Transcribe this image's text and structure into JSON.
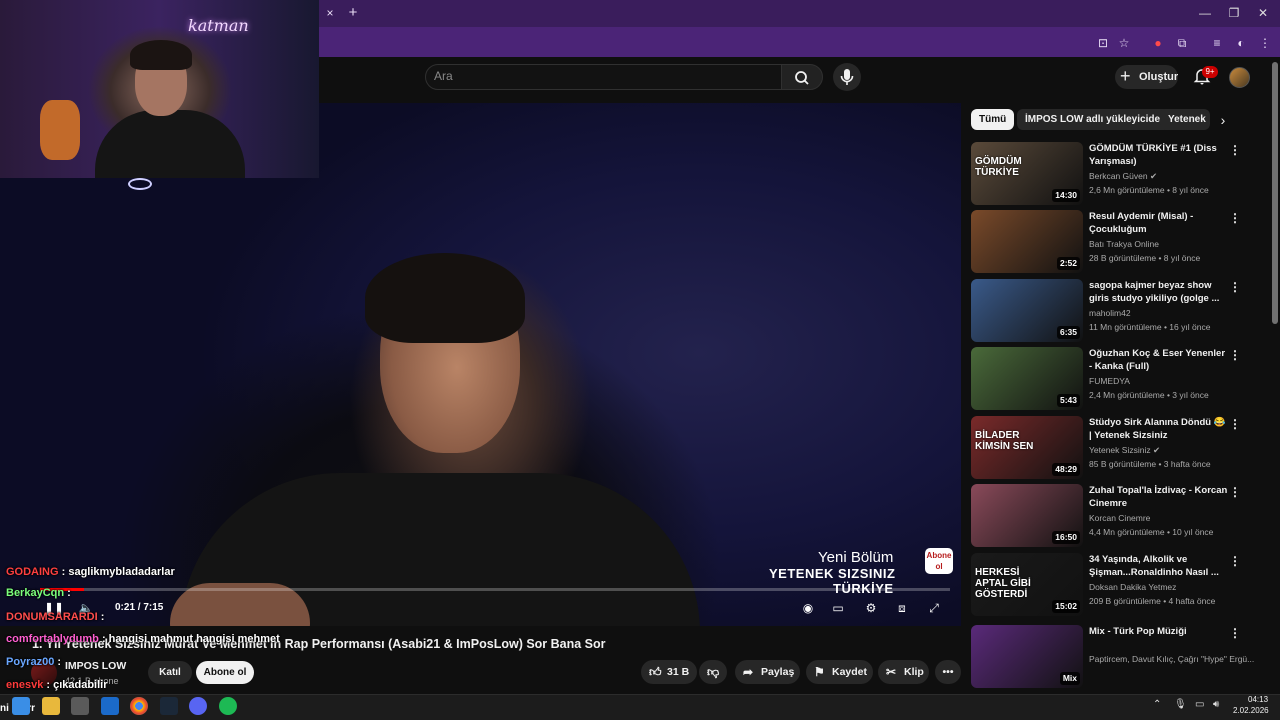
{
  "browser": {
    "tab_close": "×",
    "new_tab": "+",
    "window_min": "—",
    "window_restore": "❐",
    "window_close": "✕"
  },
  "header": {
    "search_placeholder": "Ara",
    "create_label": "Oluştur",
    "notification_count": "9+"
  },
  "stream_overlay": {
    "neon_sign": "katman"
  },
  "player": {
    "current_time": "0:21",
    "duration": "7:15",
    "time_display": "0:21 / 7:15",
    "progress": 0.048,
    "overlay_line1": "Yeni Bölüm",
    "overlay_line2": "YETENEK SIZSINIZ",
    "overlay_line3": "TÜRKİYE",
    "corner_logo": "Abone ol"
  },
  "video": {
    "title": "1. Yıl Yetenek Sizsiniz Murat Ve Mehmet'in Rap Performansı (Asabi21 & ImPosLow) Sor Bana Sor",
    "channel_name": "IMPOS LOW",
    "channel_subs": "42,1 B abone",
    "join_label": "Katıl",
    "subscribe_label": "Abone ol",
    "likes": "31 B",
    "share_label": "Paylaş",
    "save_label": "Kaydet",
    "clip_label": "Klip"
  },
  "chat": [
    {
      "user": "GODAING",
      "text": ": saglikmybladadarlar",
      "color": "#ff4040"
    },
    {
      "user": "BerkayCqn",
      "text": ":",
      "color": "#7cff7c"
    },
    {
      "user": "DONUMSARARDI",
      "text": ":",
      "color": "#ff4d4d"
    },
    {
      "user": "comfortablydumb",
      "text": ": hangisi mahmut hangisi mehmet",
      "color": "#ff5fd0"
    },
    {
      "user": "Poyraz00",
      "text": ":",
      "color": "#6aa7ff"
    },
    {
      "user": "enesvk",
      "text": ": çıkadabilir",
      "color": "#ff3b3b"
    }
  ],
  "chips": [
    {
      "label": "Tümü",
      "active": true
    },
    {
      "label": "İMPOS LOW adlı yükleyiciden",
      "active": false
    },
    {
      "label": "Yetenek",
      "active": false
    }
  ],
  "recommendations": [
    {
      "title": "GÖMDÜM TÜRKİYE #1 (Diss Yarışması)",
      "channel": "Berkcan Güven",
      "verified": true,
      "meta": "2,6 Mn görüntüleme • 8 yıl önce",
      "duration": "14:30",
      "thumb_color": "#5a4a3a",
      "thumb_text": "GÖMDÜM TÜRKİYE"
    },
    {
      "title": "Resul Aydemir (Misal) - Çocukluğum",
      "channel": "Batı Trakya Online",
      "verified": false,
      "meta": "28 B görüntüleme • 8 yıl önce",
      "duration": "2:52",
      "thumb_color": "#7a4a2a",
      "thumb_text": ""
    },
    {
      "title": "sagopa kajmer beyaz show giris studyo yikiliyo (golge ...",
      "channel": "maholim42",
      "verified": false,
      "meta": "11 Mn görüntüleme • 16 yıl önce",
      "duration": "6:35",
      "thumb_color": "#3a5a8a",
      "thumb_text": ""
    },
    {
      "title": "Oğuzhan Koç & Eser Yenenler - Kanka (Full)",
      "channel": "FUMEDYA",
      "verified": false,
      "meta": "2,4 Mn görüntüleme • 3 yıl önce",
      "duration": "5:43",
      "thumb_color": "#4a6a3a",
      "thumb_text": ""
    },
    {
      "title": "Stüdyo Sirk Alanına Döndü 😂 | Yetenek Sizsiniz",
      "channel": "Yetenek Sizsiniz",
      "verified": true,
      "meta": "85 B görüntüleme • 3 hafta önce",
      "duration": "48:29",
      "thumb_color": "#7a2a2a",
      "thumb_text": "BİLADER KİMSİN SEN"
    },
    {
      "title": "Zuhal Topal'la İzdivaç - Korcan Cinemre",
      "channel": "Korcan Cinemre",
      "verified": false,
      "meta": "4,4 Mn görüntüleme • 10 yıl önce",
      "duration": "16:50",
      "thumb_color": "#8a4a5a",
      "thumb_text": ""
    },
    {
      "title": "34 Yaşında, Alkolik ve Şişman...Ronaldinho Nasıl ...",
      "channel": "Doksan Dakika Yetmez",
      "verified": false,
      "meta": "209 B görüntüleme • 4 hafta önce",
      "duration": "15:02",
      "thumb_color": "#1a1a1a",
      "thumb_text": "HERKESİ APTAL GİBİ GÖSTERDİ"
    },
    {
      "title": "Mix - Türk Pop Müziği",
      "channel": "Paptircem, Davut Kılıç, Çağrı \"Hype\" Ergü...",
      "verified": false,
      "meta": "",
      "duration": "Mix",
      "thumb_color": "#5a2a7a",
      "thumb_text": ""
    }
  ],
  "taskbar": {
    "time": "04:13",
    "date": "2.02.2026",
    "left_text": "ni sorrr"
  }
}
